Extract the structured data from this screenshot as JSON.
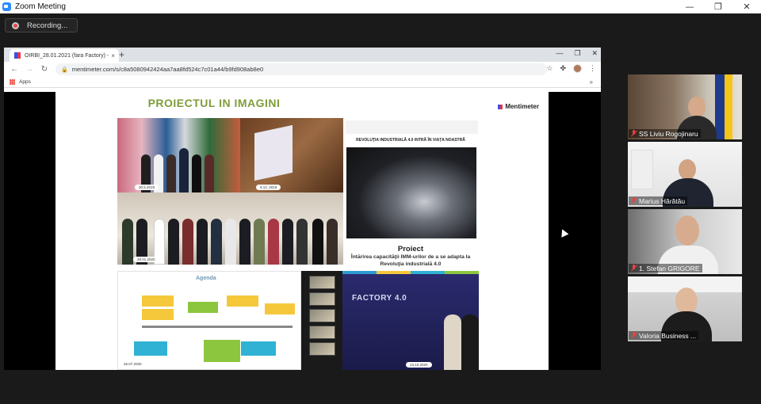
{
  "window": {
    "title": "Zoom Meeting",
    "min": "—",
    "restore": "❐",
    "close": "✕"
  },
  "recording": {
    "label": "Recording..."
  },
  "browser": {
    "tab_title": "OIRBI_28.01.2021 (fara Factory) -",
    "tab_close": "×",
    "new_tab": "+",
    "url": "mentimeter.com/s/c8a5080942424aa7aa8fd524c7c01a44/b9fd908ab8e0",
    "bookmarks_apps": "Apps",
    "bookmarks_more": "»"
  },
  "slide": {
    "title": "PROIECTUL IN IMAGINI",
    "brand": "Mentimeter",
    "photos": {
      "p1_date": "30.5.2019",
      "p2_date": "9.12..2019",
      "p3_date": "28.01.2020",
      "p5_date": "26.07.2020",
      "p7_date": "13.10.2020"
    },
    "revolution_text": "REVOLUȚIA INDUSTRIALĂ 4.0 INTRĂ ÎN VIAȚA NOASTRĂ",
    "project_title": "Proiect",
    "project_text": "Întărirea capacităţii IMM-urilor de a se adapta la Revoluţia industrială 4.0",
    "agenda_title": "Agenda",
    "factory_text": "FACTORY 4.0"
  },
  "participants": [
    {
      "name": "SS Liviu Rogojinaru"
    },
    {
      "name": "Marius Hărătău"
    },
    {
      "name": "1. Stefan GRIGORE"
    },
    {
      "name": "Valoria Business ..."
    }
  ],
  "colors": {
    "accent_green": "#7f9c3a",
    "zoom_blue": "#2d8cff",
    "muted_red": "#e64343"
  }
}
